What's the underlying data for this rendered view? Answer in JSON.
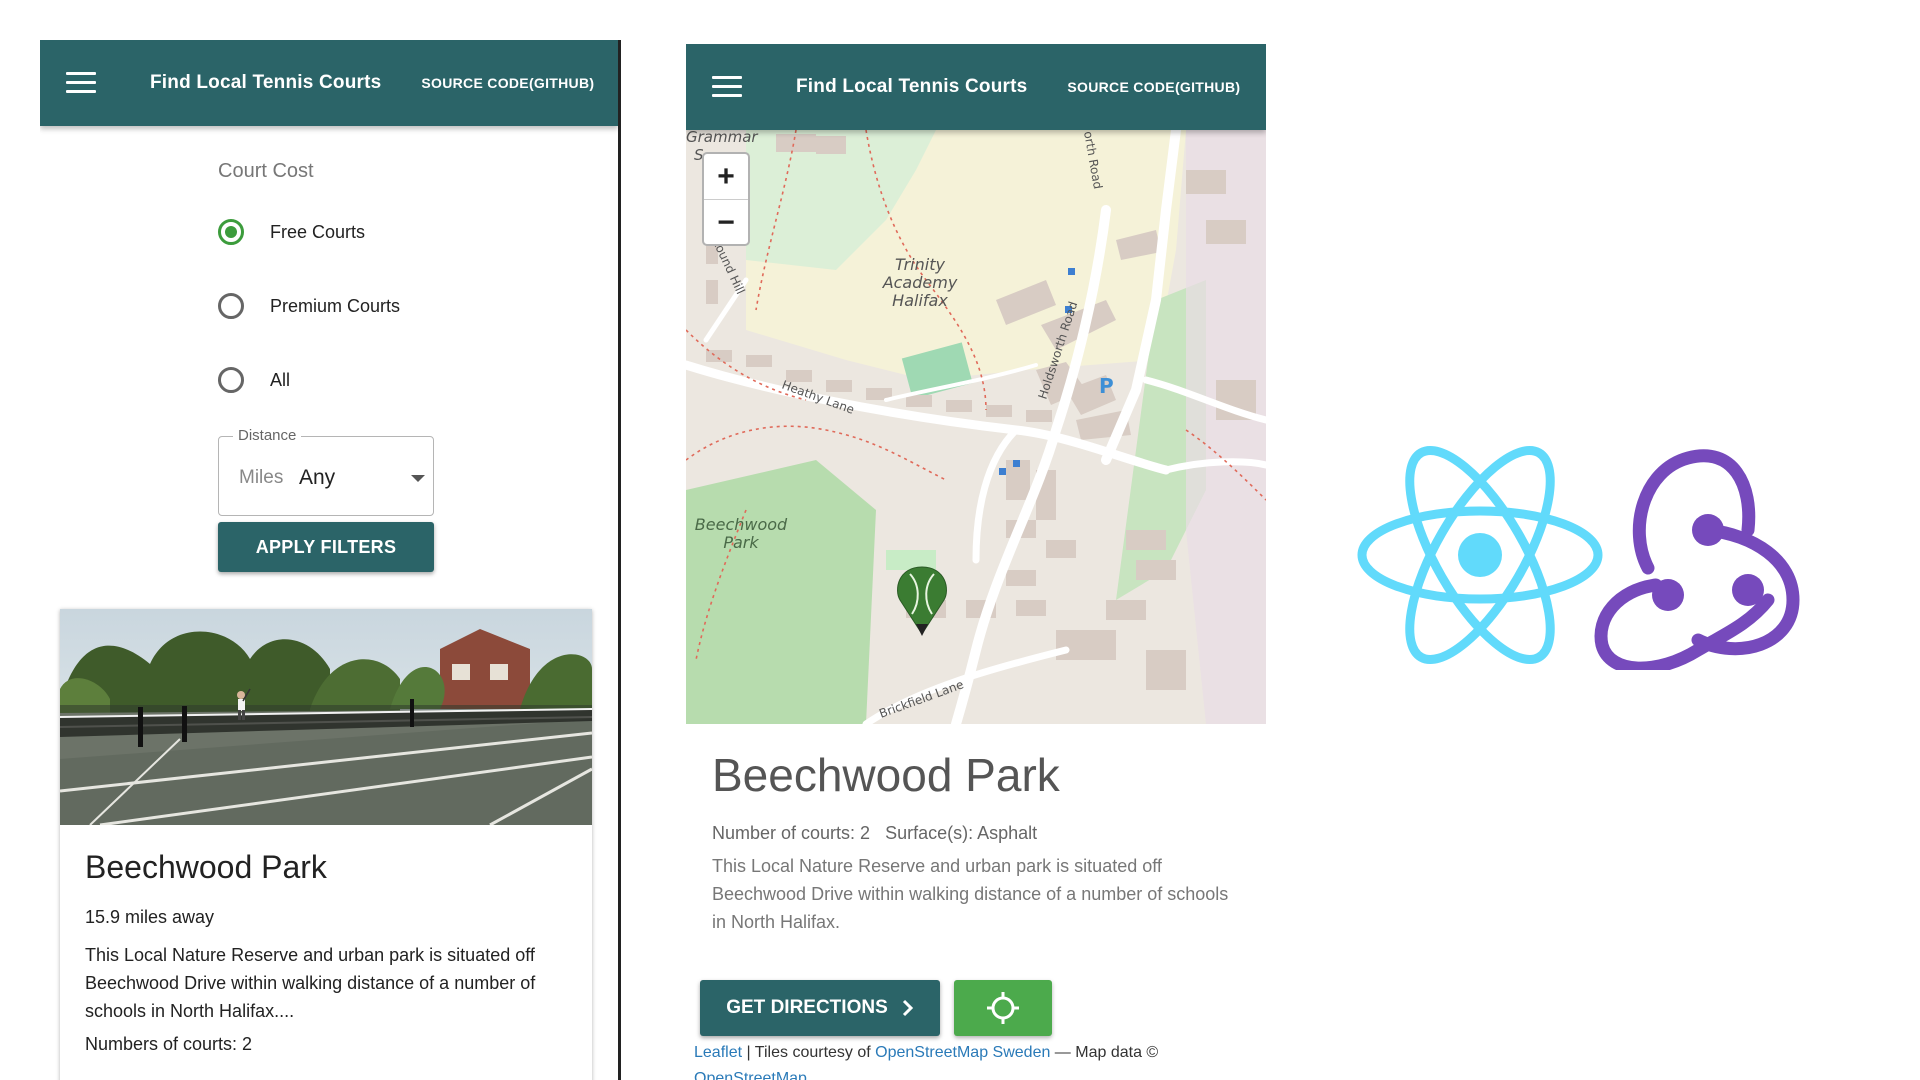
{
  "app": {
    "title": "Find Local Tennis Courts",
    "source_link": "SOURCE CODE(GITHUB)",
    "accent_color": "#2b6468",
    "radio_color": "#3c9c3c"
  },
  "filters": {
    "section_label": "Court Cost",
    "options": [
      {
        "label": "Free Courts",
        "checked": true
      },
      {
        "label": "Premium Courts",
        "checked": false
      },
      {
        "label": "All",
        "checked": false
      }
    ],
    "distance": {
      "legend": "Distance",
      "prefix": "Miles",
      "value": "Any"
    },
    "apply_label": "APPLY FILTERS"
  },
  "list_card": {
    "title": "Beechwood Park",
    "distance": "15.9 miles away",
    "description": "This Local Nature Reserve and urban park is situated off Beechwood Drive within walking distance of a number of schools in North Halifax....",
    "courts": "Numbers of courts: 2"
  },
  "map": {
    "labels": {
      "grammar": "Grammar",
      "s": "S",
      "trinity": [
        "Trinity",
        "Academy",
        "Halifax"
      ],
      "beechwood": [
        "Beechwood",
        "Park"
      ],
      "heathy_lane": "Heathy Lane",
      "round_hill": "Round Hill",
      "holdsworth_road": "Holdsworth Road",
      "north_road": "orth Road",
      "brickfield_lane": "Brickfield Lane",
      "parking": "P"
    },
    "zoom_in": "+",
    "zoom_out": "−"
  },
  "detail": {
    "title": "Beechwood Park",
    "meta": "Number of courts: 2   Surface(s): Asphalt",
    "description": "This Local Nature Reserve and urban park is situated off Beechwood Drive within walking distance of a number of schools in North Halifax.",
    "directions_label": "GET DIRECTIONS",
    "locate_color": "#4caa4c"
  },
  "attribution": {
    "leaflet": "Leaflet",
    "sep": " | Tiles courtesy of ",
    "osm_sweden": "OpenStreetMap Sweden",
    "map_data": " — Map data © ",
    "osm": "OpenStreetMap"
  },
  "logos": [
    {
      "icon": "react-logo-icon",
      "color": "#61dafb"
    },
    {
      "icon": "redux-logo-icon",
      "color": "#764abc"
    }
  ]
}
